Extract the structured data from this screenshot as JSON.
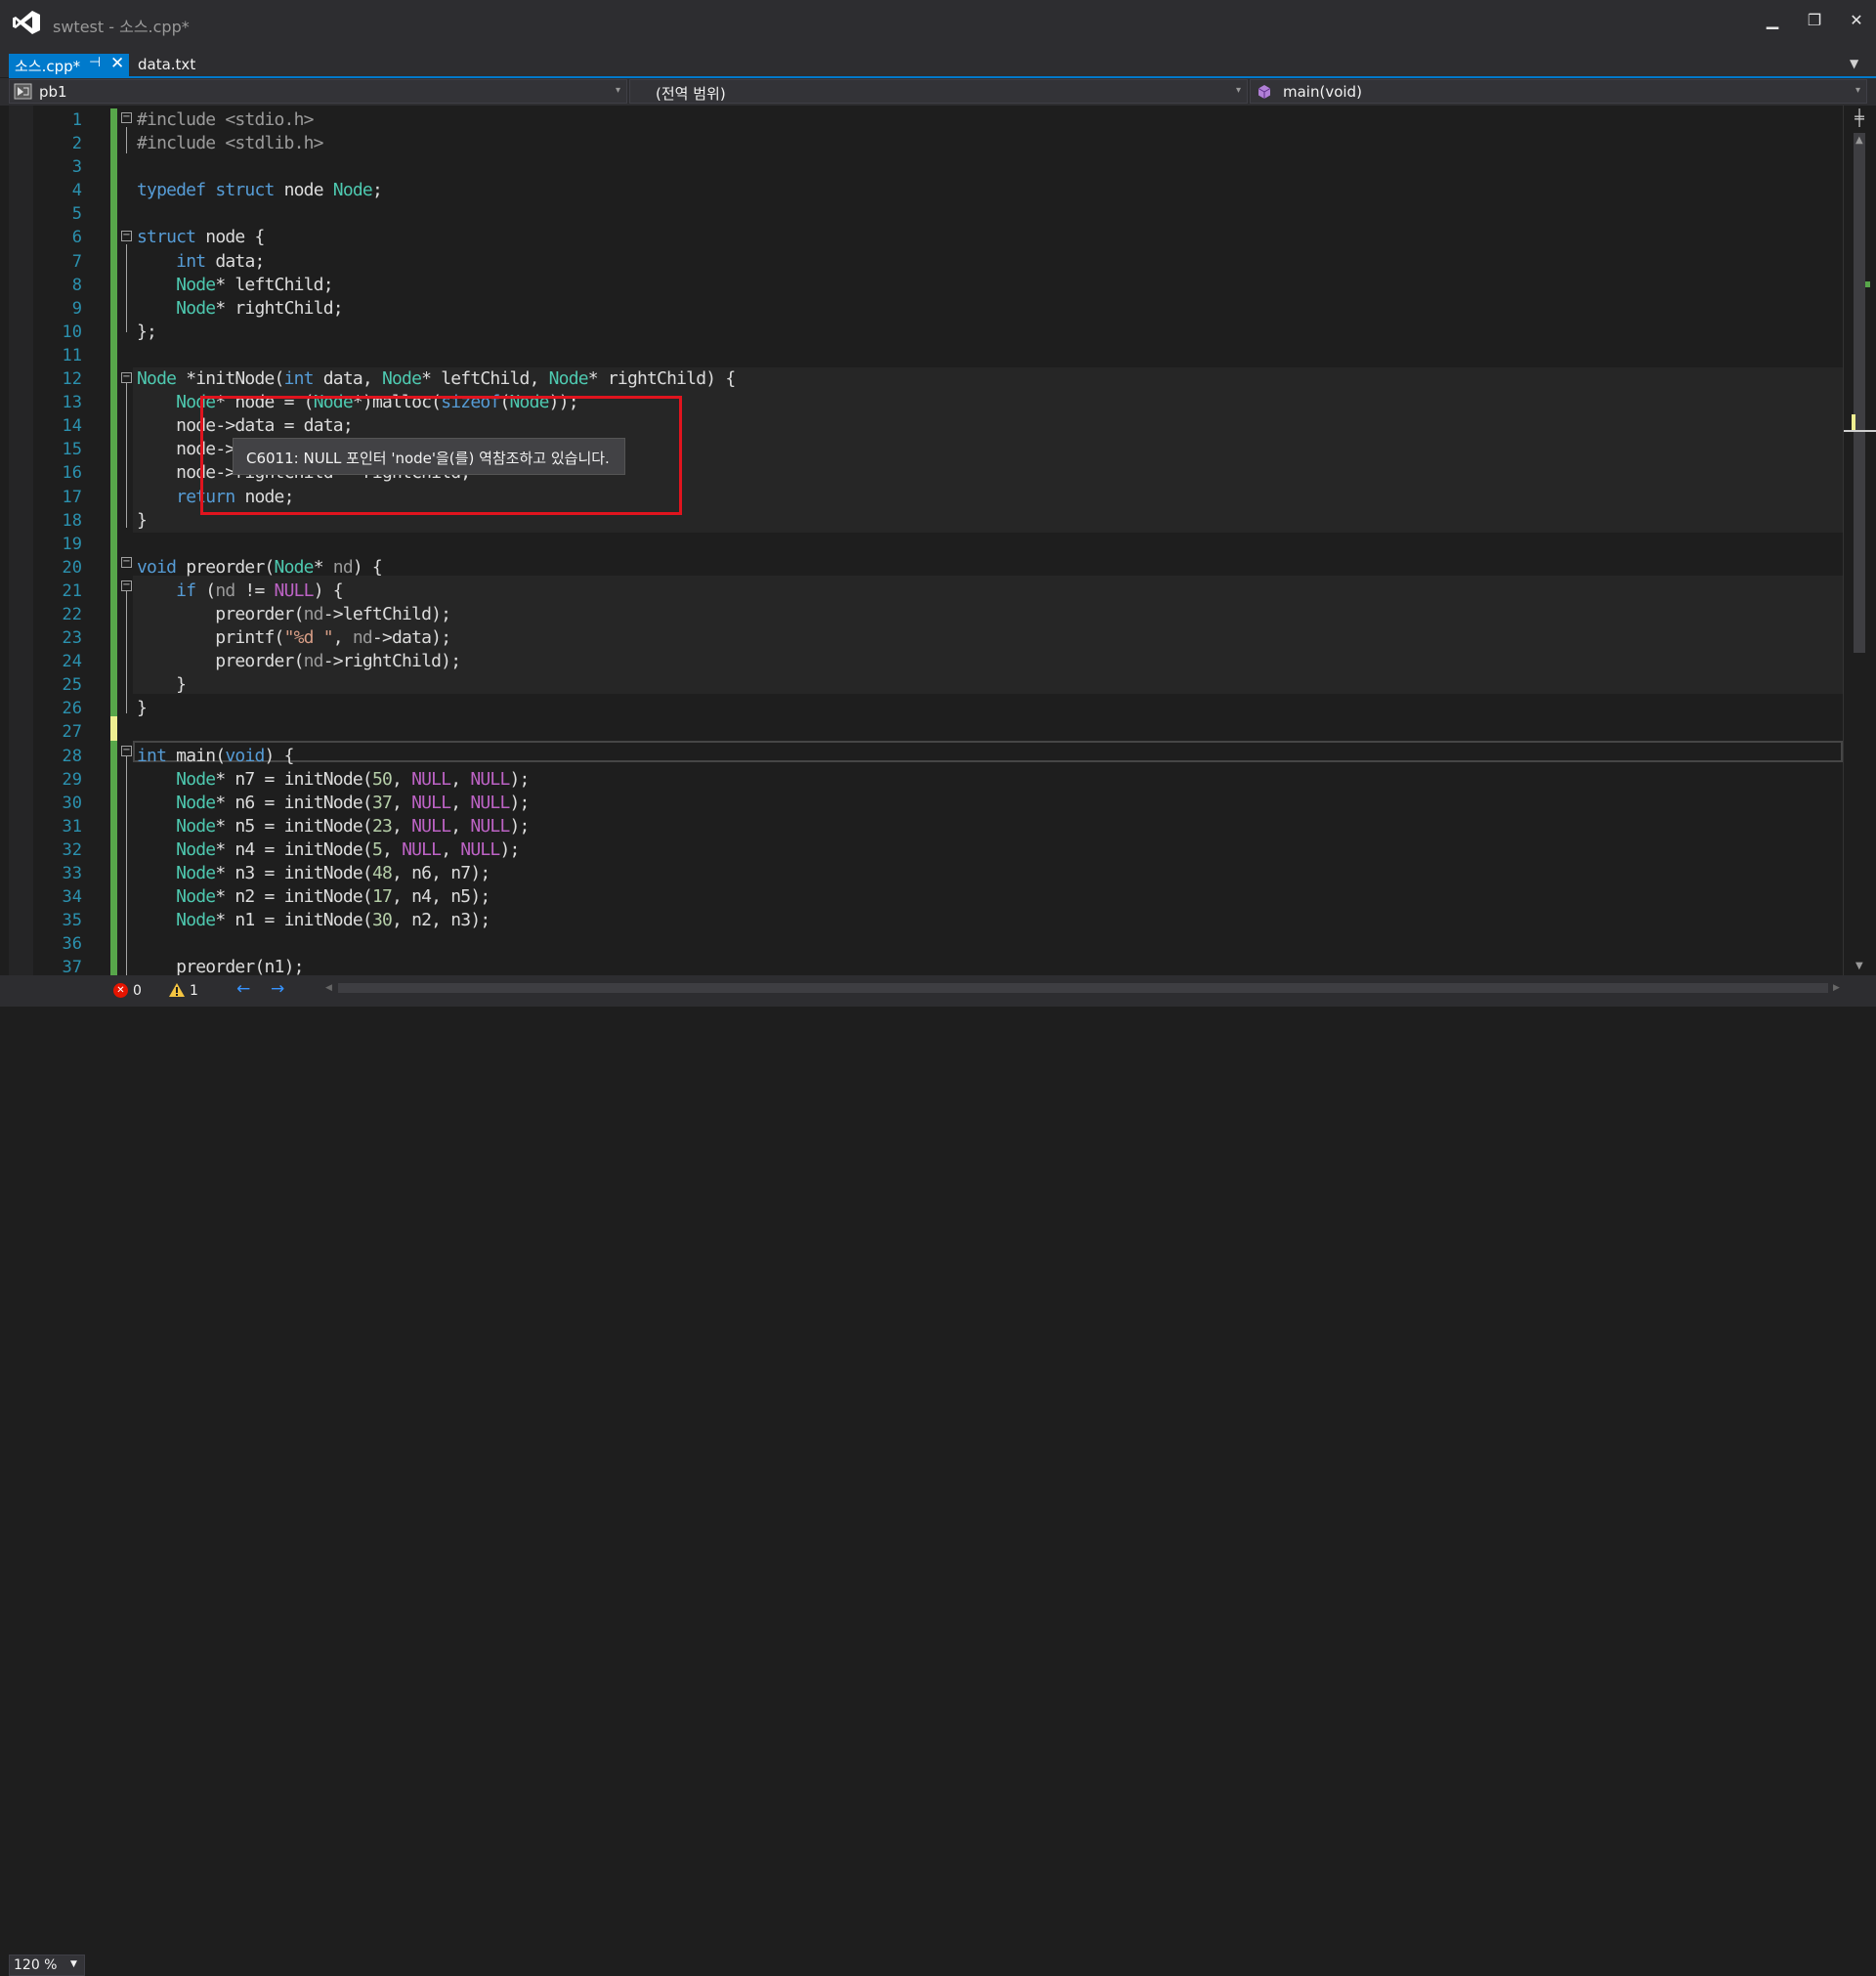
{
  "window": {
    "title": "swtest - 소스.cpp*",
    "minimize_glyph": "▁",
    "restore_glyph": "❐",
    "close_glyph": "✕"
  },
  "tabs": [
    {
      "label": "소스.cpp*",
      "active": true,
      "pin_glyph": "⊣",
      "close_glyph": "✕"
    },
    {
      "label": "data.txt",
      "active": false
    }
  ],
  "tab_overflow_glyph": "▼",
  "navbar": {
    "project": "pb1",
    "scope": "(전역 범위)",
    "member": "main(void)",
    "dropdown_glyph": "▾"
  },
  "editor": {
    "line_numbers": [
      "1",
      "2",
      "3",
      "4",
      "5",
      "6",
      "7",
      "8",
      "9",
      "10",
      "11",
      "12",
      "13",
      "14",
      "15",
      "16",
      "17",
      "18",
      "19",
      "20",
      "21",
      "22",
      "23",
      "24",
      "25",
      "26",
      "27",
      "28",
      "29",
      "30",
      "31",
      "32",
      "33",
      "34",
      "35",
      "36",
      "37"
    ],
    "lines": [
      "#include <stdio.h>",
      "#include <stdlib.h>",
      "",
      "typedef struct node Node;",
      "",
      "struct node {",
      "    int data;",
      "    Node* leftChild;",
      "    Node* rightChild;",
      "};",
      "",
      "Node *initNode(int data, Node* leftChild, Node* rightChild) {",
      "    Node* node = (Node*)malloc(sizeof(Node));",
      "    node->data = data;",
      "    node->leftChild = leftChild;",
      "    node->rightChild = rightChild;",
      "    return node;",
      "}",
      "",
      "void preorder(Node* nd) {",
      "    if (nd != NULL) {",
      "        preorder(nd->leftChild);",
      "        printf(\"%d \", nd->data);",
      "        preorder(nd->rightChild);",
      "    }",
      "}",
      "",
      "int main(void) {",
      "    Node* n7 = initNode(50, NULL, NULL);",
      "    Node* n6 = initNode(37, NULL, NULL);",
      "    Node* n5 = initNode(23, NULL, NULL);",
      "    Node* n4 = initNode(5, NULL, NULL);",
      "    Node* n3 = initNode(48, n6, n7);",
      "    Node* n2 = initNode(17, n4, n5);",
      "    Node* n1 = initNode(30, n2, n3);",
      "",
      "    preorder(n1);"
    ],
    "tooltip": "C6011: NULL 포인터 'node'을(를) 역참조하고 있습니다.",
    "fold_glyph": "−"
  },
  "statusbar": {
    "zoom": "120 %",
    "errors": "0",
    "warnings": "1",
    "back_glyph": "←",
    "forward_glyph": "→",
    "error_glyph": "✕",
    "warning_glyph": "!"
  },
  "colors": {
    "accent": "#007acc",
    "keyword": "#569cd6",
    "type": "#4ec9b0",
    "macro": "#bd63c5",
    "highlight_box": "#e0141e"
  }
}
